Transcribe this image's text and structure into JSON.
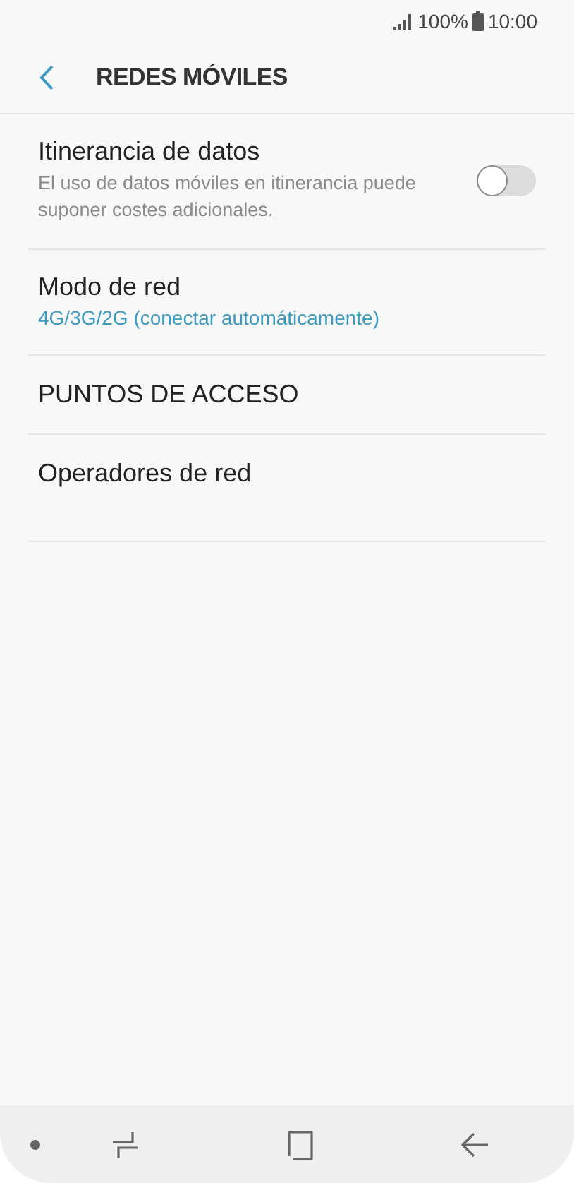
{
  "status_bar": {
    "battery": "100%",
    "time": "10:00"
  },
  "header": {
    "title": "REDES MÓVILES"
  },
  "settings": [
    {
      "kind": "toggle",
      "title": "Itinerancia de datos",
      "summary": "El uso de datos móviles en itinerancia puede suponer costes adicionales.",
      "on": false
    },
    {
      "kind": "value",
      "title": "Modo de red",
      "value": "4G/3G/2G (conectar automáticamente)"
    },
    {
      "kind": "link",
      "title": "PUNTOS DE ACCESO"
    },
    {
      "kind": "link",
      "title": "Operadores de red"
    }
  ]
}
